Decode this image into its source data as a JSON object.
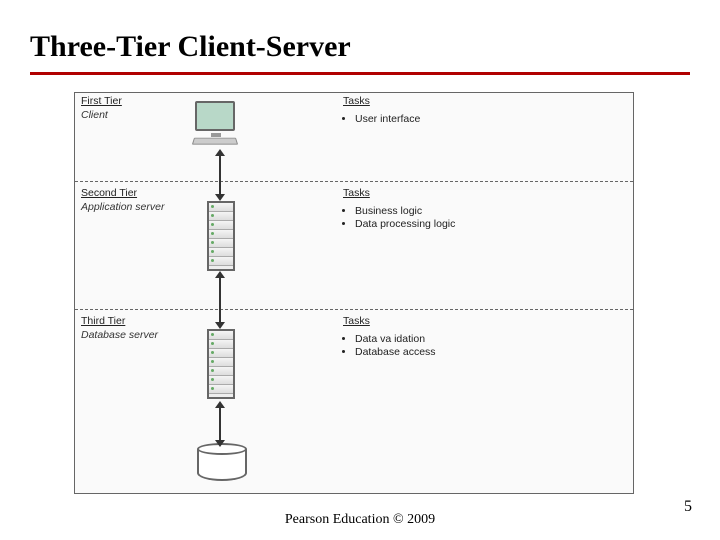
{
  "title": "Three-Tier Client-Server",
  "tiers": [
    {
      "name": "First Tier",
      "role": "Client",
      "tasks_head": "Tasks",
      "tasks": [
        "User interface"
      ]
    },
    {
      "name": "Second Tier",
      "role": "Application server",
      "tasks_head": "Tasks",
      "tasks": [
        "Business logic",
        "Data processing logic"
      ]
    },
    {
      "name": "Third Tier",
      "role": "Database server",
      "tasks_head": "Tasks",
      "tasks": [
        "Data va idation",
        "Database access"
      ]
    }
  ],
  "footer": "Pearson Education © 2009",
  "page_number": "5"
}
